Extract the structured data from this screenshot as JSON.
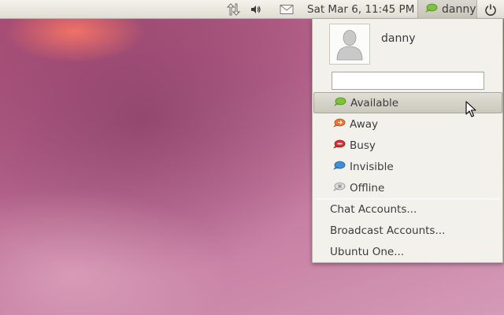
{
  "panel": {
    "clock": "Sat Mar  6, 11:45 PM",
    "me_name": "danny",
    "icons": [
      "network-icon",
      "volume-icon",
      "mail-icon",
      "status-available-icon",
      "power-icon"
    ]
  },
  "menu": {
    "user_name": "danny",
    "status_input_value": "",
    "status_items": [
      {
        "label": "Available",
        "color": "#7cc23a",
        "icon": "available-icon",
        "selected": true
      },
      {
        "label": "Away",
        "color": "#e8783a",
        "icon": "away-icon"
      },
      {
        "label": "Busy",
        "color": "#d63030",
        "icon": "busy-icon"
      },
      {
        "label": "Invisible",
        "color": "#3f8fd8",
        "icon": "invisible-icon"
      },
      {
        "label": "Offline",
        "color": "#c9c9c9",
        "icon": "offline-icon"
      }
    ],
    "account_items": [
      {
        "label": "Chat Accounts..."
      },
      {
        "label": "Broadcast Accounts..."
      },
      {
        "label": "Ubuntu One..."
      }
    ]
  },
  "colors": {
    "panel_bg": "#e8e6df",
    "menu_bg": "#f3f1ec",
    "available": "#7cc23a"
  }
}
